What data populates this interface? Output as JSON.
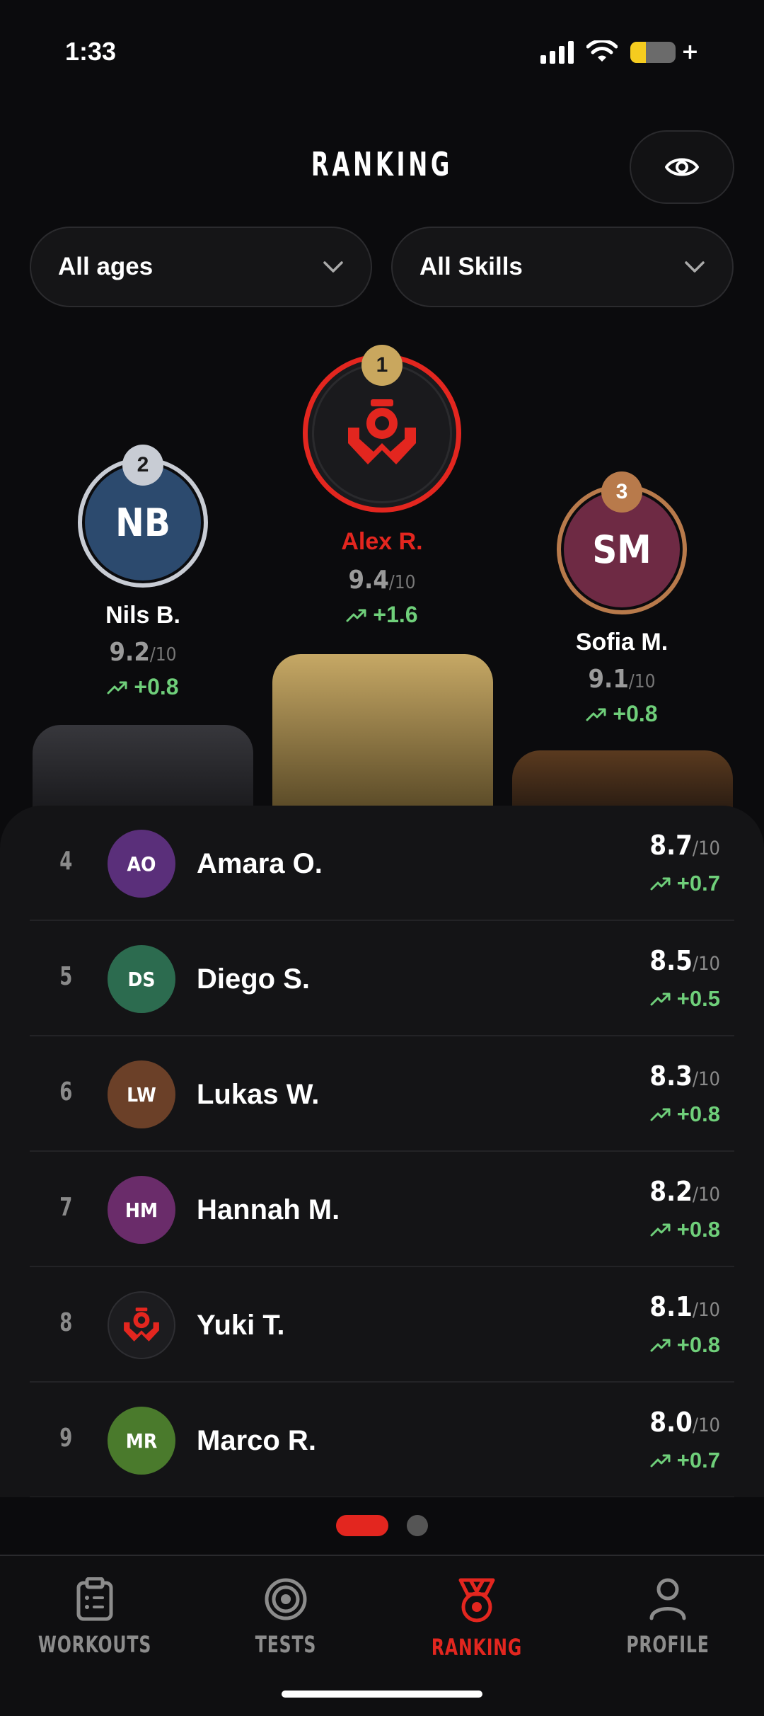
{
  "status": {
    "time": "1:33",
    "battery_level": 0.35
  },
  "header": {
    "title": "RANKING"
  },
  "filters": [
    {
      "label": "All ages"
    },
    {
      "label": "All Skills"
    }
  ],
  "podium": {
    "first": {
      "rank": "1",
      "name": "Alex R.",
      "score": "9.4",
      "out_of": "/10",
      "delta": "+1.6"
    },
    "second": {
      "rank": "2",
      "initials": "NB",
      "name": "Nils B.",
      "score": "9.2",
      "out_of": "/10",
      "delta": "+0.8"
    },
    "third": {
      "rank": "3",
      "initials": "SM",
      "name": "Sofia M.",
      "score": "9.1",
      "out_of": "/10",
      "delta": "+0.8"
    }
  },
  "list": [
    {
      "rank": "4",
      "initials": "AO",
      "name": "Amara O.",
      "score": "8.7",
      "out_of": "/10",
      "delta": "+0.7",
      "color": "#5a2f7a"
    },
    {
      "rank": "5",
      "initials": "DS",
      "name": "Diego S.",
      "score": "8.5",
      "out_of": "/10",
      "delta": "+0.5",
      "color": "#2c6b4f"
    },
    {
      "rank": "6",
      "initials": "LW",
      "name": "Lukas W.",
      "score": "8.3",
      "out_of": "/10",
      "delta": "+0.8",
      "color": "#6b4028"
    },
    {
      "rank": "7",
      "initials": "HM",
      "name": "Hannah M.",
      "score": "8.2",
      "out_of": "/10",
      "delta": "+0.8",
      "color": "#6a2c6a"
    },
    {
      "rank": "8",
      "initials": "",
      "name": "Yuki T.",
      "score": "8.1",
      "out_of": "/10",
      "delta": "+0.8",
      "color": "#1c1c1f"
    },
    {
      "rank": "9",
      "initials": "MR",
      "name": "Marco R.",
      "score": "8.0",
      "out_of": "/10",
      "delta": "+0.7",
      "color": "#4a7a2c"
    }
  ],
  "pager": {
    "pages": 2,
    "current": 1
  },
  "tabs": [
    {
      "label": "WORKOUTS",
      "icon": "clipboard-icon"
    },
    {
      "label": "TESTS",
      "icon": "target-icon"
    },
    {
      "label": "RANKING",
      "icon": "medal-icon",
      "active": true
    },
    {
      "label": "PROFILE",
      "icon": "person-icon"
    }
  ],
  "colors": {
    "accent": "#e3261f",
    "positive": "#6fcf7a",
    "gold": "#c9a75e",
    "silver": "#c8ccd4",
    "bronze": "#b87a4b"
  }
}
